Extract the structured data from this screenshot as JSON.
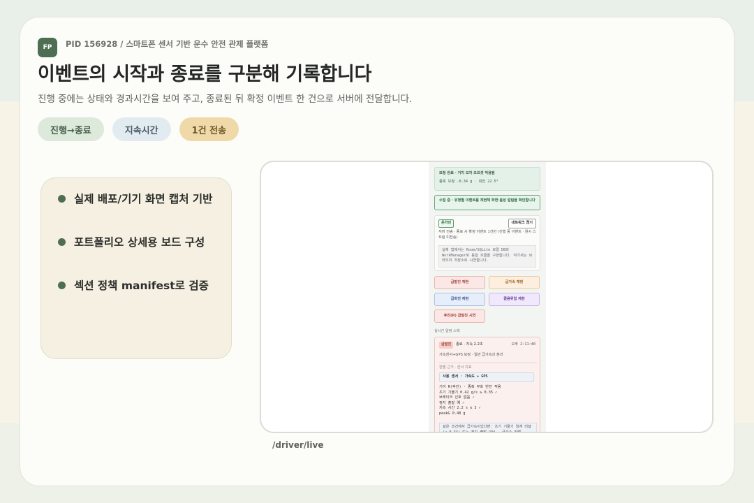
{
  "header": {
    "logo": "FP",
    "pid": "PID 156928 / 스마트폰 센서 기반 운수 안전 관제 플랫폼",
    "title": "이벤트의 시작과 종료를 구분해 기록합니다",
    "subtitle": "진행 중에는 상태와 경과시간을 보여 주고, 종료된 뒤 확정 이벤트 한 건으로 서버에 전달합니다."
  },
  "chips": [
    "진행→종료",
    "지속시간",
    "1건 전송"
  ],
  "features": [
    "실제 배포/기기 화면 캡처 기반",
    "포트폴리오 상세용 보드 구성",
    "섹션 정책 manifest로 검증"
  ],
  "caption": "/driver/live",
  "phone": {
    "done_title": "보정 완료 · 거치 오차 오프셋 적용됨",
    "done_detail": "종축 보정 -0.34 g · 회전 22.5°",
    "collect": "수집 중 · 유형별 이벤트를 재현해 화면·음성 알림을 확인합니다",
    "online_badge": "온라인",
    "network_button": "네트워크 끊기",
    "online_desc": "서버 전송 · 종료 시 확정 이벤트 1건만 (진행 중 이벤트 · 원시 스트림 미전송)",
    "online_note": "실제 앱에서는 Room/SQLite 로컬 DB와 WorkManager로 동일 흐름을 구현합니다. 여기서는 브라우저 저장소로 시연합니다.",
    "buttons": {
      "brake": "급발진 재현",
      "accel": "급가속 재현",
      "turn": "급회전 재현",
      "lane": "졸음위험 재현",
      "rear": "후진(R) 급발진 시연"
    },
    "realtime_label": "실시간 알림 스택",
    "event": {
      "badge": "급발진",
      "status": "종료 · 지속 2.2초",
      "time": "오후 2:11:40",
      "sensor": "가속센서+GPS 보정 · 일반 급가속과 분리",
      "basis": "판별 근거 · 센서 지표",
      "used": "사용 센서 · 가속도 + GPS",
      "lines": [
        "기어 R(후진) · 종축 부호 반전 적용",
        "초기 기울기 0.42 g/s ≥ 0.35 ✓",
        "브레이크 신호 없음 ✓",
        "정지 출발 예 ✓",
        "지속 시간 2.2 s ≤ 3 ✓",
        "peakG 0.48 g"
      ],
      "note": "같은 조건에서 급가속이었다면: 초기 기울기 임계 미달(< 0.34) 또는 정지 출발 아님 → 급가속 라벨"
    }
  }
}
